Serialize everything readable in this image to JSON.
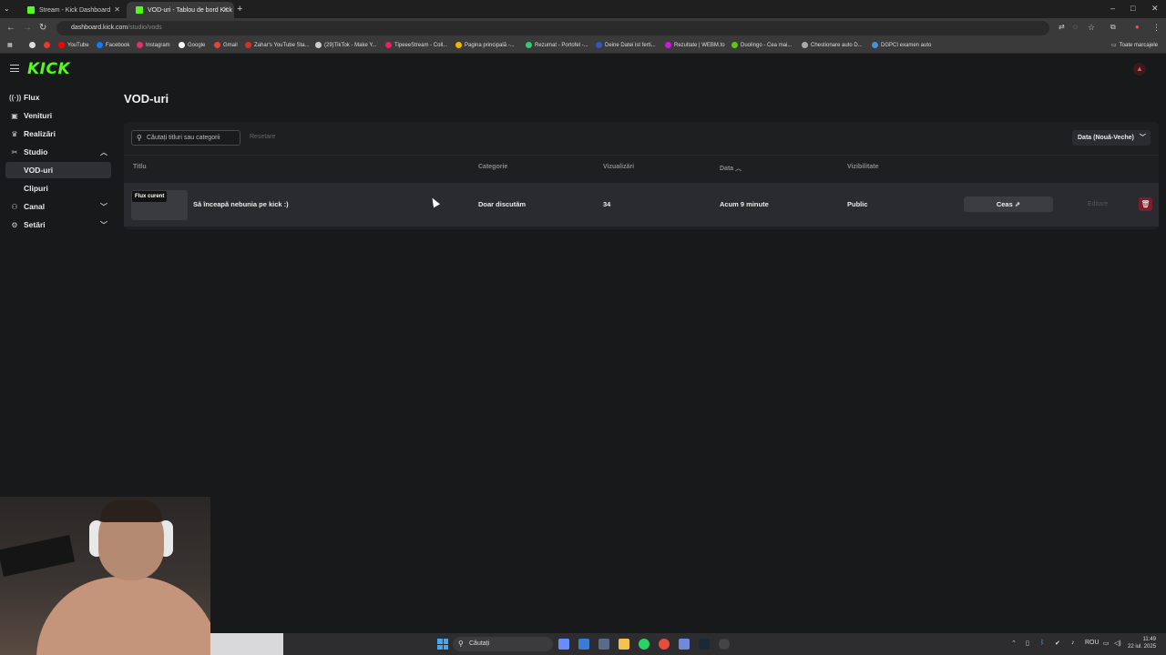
{
  "browser": {
    "tabs": [
      {
        "label": "Stream - Kick Dashboard"
      },
      {
        "label": "VOD-uri - Tablou de bord Kick"
      }
    ],
    "address": {
      "host": "dashboard.kick.com",
      "path": "/studio/vods"
    },
    "bookmarks": [
      {
        "label": "YouTube",
        "color": "#ff0000"
      },
      {
        "label": "Facebook",
        "color": "#1877f2"
      },
      {
        "label": "Instagram",
        "color": "#e1306c"
      },
      {
        "label": "Google",
        "color": "#ffffff"
      },
      {
        "label": "Gmail",
        "color": "#ea4335"
      },
      {
        "label": "Zahar's YouTube Sta...",
        "color": "#d93025"
      },
      {
        "label": "(29)TikTok - Make Y...",
        "color": "#cccccc"
      },
      {
        "label": "TipeeeStream - Coll...",
        "color": "#e91e63"
      },
      {
        "label": "Pagina principală -...",
        "color": "#f4b400"
      },
      {
        "label": "Rezumat - Portofel -...",
        "color": "#2ecc71"
      },
      {
        "label": "Deine Datei ist ferti...",
        "color": "#3f51b5"
      },
      {
        "label": "Rezultate | WEBM.to",
        "color": "#c51dd6"
      },
      {
        "label": "Duolingo - Cea mai...",
        "color": "#58cc02"
      },
      {
        "label": "Chestionare auto D...",
        "color": "#aaaaaa"
      },
      {
        "label": "DGPCI examen auto",
        "color": "#4a90d9"
      }
    ],
    "all_bookmarks": "Toate marcajele"
  },
  "kick": {
    "logo": "KICK",
    "logo_color": "#53fc18"
  },
  "sidebar": {
    "items": [
      {
        "label": "Flux",
        "icon": "broadcast-icon"
      },
      {
        "label": "Venituri",
        "icon": "wallet-icon"
      },
      {
        "label": "Realizări",
        "icon": "trophy-icon"
      },
      {
        "label": "Studio",
        "icon": "film-icon"
      },
      {
        "label": "VOD-uri"
      },
      {
        "label": "Clipuri"
      },
      {
        "label": "Canal",
        "icon": "people-icon"
      },
      {
        "label": "Setări",
        "icon": "gear-icon"
      }
    ]
  },
  "main": {
    "title": "VOD-uri",
    "search_placeholder": "Căutați titluri sau categorii",
    "reset_label": "Resetare",
    "sort_label": "Data (Nouă-Veche)",
    "columns": [
      "Titlu",
      "Categorie",
      "Vizualizări",
      "Data",
      "Vizibilitate"
    ],
    "rows": [
      {
        "badge": "Flux curent",
        "title": "Să înceapă nebunia pe kick :)",
        "category": "Doar discutăm",
        "views": "34",
        "date": "Acum 9 minute",
        "visibility": "Public",
        "watch_label": "Ceas",
        "edit_label": "Editare"
      }
    ],
    "delete_color": "#7a1d2e"
  },
  "taskbar": {
    "search_label": "Căutați",
    "lang": "ROU",
    "time": "11:49",
    "date": "22 iul. 2025"
  }
}
